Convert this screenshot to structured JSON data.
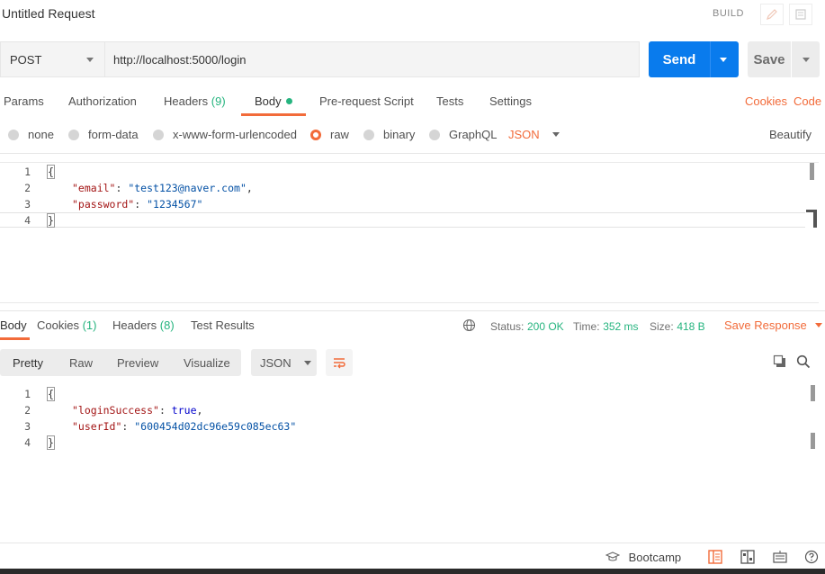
{
  "header": {
    "title": "Untitled Request",
    "build_label": "BUILD"
  },
  "request": {
    "method": "POST",
    "url": "http://localhost:5000/login",
    "send_label": "Send",
    "save_label": "Save"
  },
  "request_tabs": {
    "params": "Params",
    "authorization": "Authorization",
    "headers": "Headers",
    "headers_count": "(9)",
    "body": "Body",
    "prerequest": "Pre-request Script",
    "tests": "Tests",
    "settings": "Settings",
    "cookies": "Cookies",
    "code": "Code"
  },
  "body_types": {
    "none": "none",
    "form_data": "form-data",
    "urlencoded": "x-www-form-urlencoded",
    "raw": "raw",
    "binary": "binary",
    "graphql": "GraphQL",
    "format": "JSON",
    "beautify": "Beautify",
    "selected": "raw"
  },
  "request_body": {
    "lines": [
      "1",
      "2",
      "3",
      "4"
    ],
    "open": "{",
    "close": "}",
    "k1": "\"email\"",
    "v1": "\"test123@naver.com\"",
    "k2": "\"password\"",
    "v2": "\"1234567\""
  },
  "response_tabs": {
    "body": "Body",
    "cookies": "Cookies",
    "cookies_count": "(1)",
    "headers": "Headers",
    "headers_count": "(8)",
    "test_results": "Test Results"
  },
  "response_status": {
    "status_label": "Status:",
    "status": "200 OK",
    "time_label": "Time:",
    "time": "352 ms",
    "size_label": "Size:",
    "size": "418 B",
    "save_response": "Save Response"
  },
  "response_view": {
    "pretty": "Pretty",
    "raw": "Raw",
    "preview": "Preview",
    "visualize": "Visualize",
    "format": "JSON"
  },
  "response_body": {
    "lines": [
      "1",
      "2",
      "3",
      "4"
    ],
    "open": "{",
    "close": "}",
    "k1": "\"loginSuccess\"",
    "v1": "true",
    "k2": "\"userId\"",
    "v2": "\"600454d02dc96e59c085ec63\""
  },
  "footer": {
    "bootcamp": "Bootcamp"
  },
  "colors": {
    "accent": "#f26b3a",
    "primary": "#097bed",
    "success": "#26b47f"
  }
}
